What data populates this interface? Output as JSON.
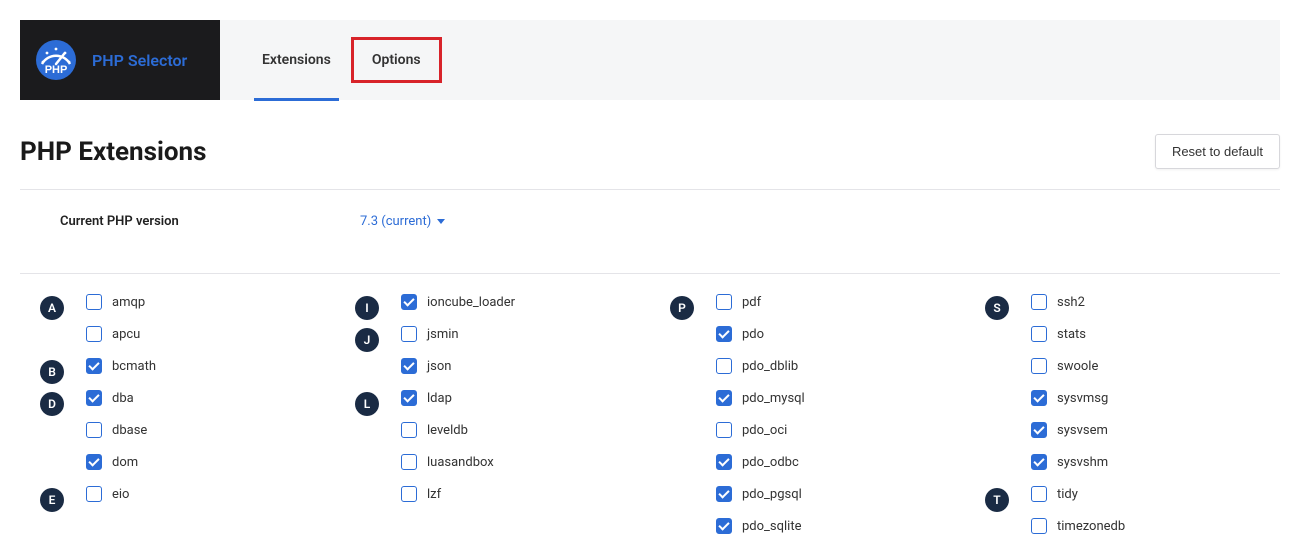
{
  "brand": {
    "title": "PHP Selector"
  },
  "tabs": {
    "extensions": "Extensions",
    "options": "Options"
  },
  "section": {
    "title": "PHP Extensions",
    "reset_label": "Reset to default"
  },
  "version": {
    "label": "Current PHP version",
    "value": "7.3 (current)"
  },
  "columns": [
    [
      {
        "letter": "A",
        "items": [
          {
            "name": "amqp",
            "checked": false
          },
          {
            "name": "apcu",
            "checked": false
          }
        ]
      },
      {
        "letter": "B",
        "items": [
          {
            "name": "bcmath",
            "checked": true
          }
        ]
      },
      {
        "letter": "D",
        "items": [
          {
            "name": "dba",
            "checked": true
          },
          {
            "name": "dbase",
            "checked": false
          },
          {
            "name": "dom",
            "checked": true
          }
        ]
      },
      {
        "letter": "E",
        "items": [
          {
            "name": "eio",
            "checked": false
          }
        ]
      }
    ],
    [
      {
        "letter": "I",
        "items": [
          {
            "name": "ioncube_loader",
            "checked": true
          }
        ]
      },
      {
        "letter": "J",
        "items": [
          {
            "name": "jsmin",
            "checked": false
          },
          {
            "name": "json",
            "checked": true
          }
        ]
      },
      {
        "letter": "L",
        "items": [
          {
            "name": "ldap",
            "checked": true
          },
          {
            "name": "leveldb",
            "checked": false
          },
          {
            "name": "luasandbox",
            "checked": false
          },
          {
            "name": "lzf",
            "checked": false
          }
        ]
      }
    ],
    [
      {
        "letter": "P",
        "items": [
          {
            "name": "pdf",
            "checked": false
          },
          {
            "name": "pdo",
            "checked": true
          },
          {
            "name": "pdo_dblib",
            "checked": false
          },
          {
            "name": "pdo_mysql",
            "checked": true
          },
          {
            "name": "pdo_oci",
            "checked": false
          },
          {
            "name": "pdo_odbc",
            "checked": true
          },
          {
            "name": "pdo_pgsql",
            "checked": true
          },
          {
            "name": "pdo_sqlite",
            "checked": true
          }
        ]
      }
    ],
    [
      {
        "letter": "S",
        "items": [
          {
            "name": "ssh2",
            "checked": false
          },
          {
            "name": "stats",
            "checked": false
          },
          {
            "name": "swoole",
            "checked": false
          },
          {
            "name": "sysvmsg",
            "checked": true
          },
          {
            "name": "sysvsem",
            "checked": true
          },
          {
            "name": "sysvshm",
            "checked": true
          }
        ]
      },
      {
        "letter": "T",
        "items": [
          {
            "name": "tidy",
            "checked": false
          },
          {
            "name": "timezonedb",
            "checked": false
          }
        ]
      }
    ]
  ]
}
